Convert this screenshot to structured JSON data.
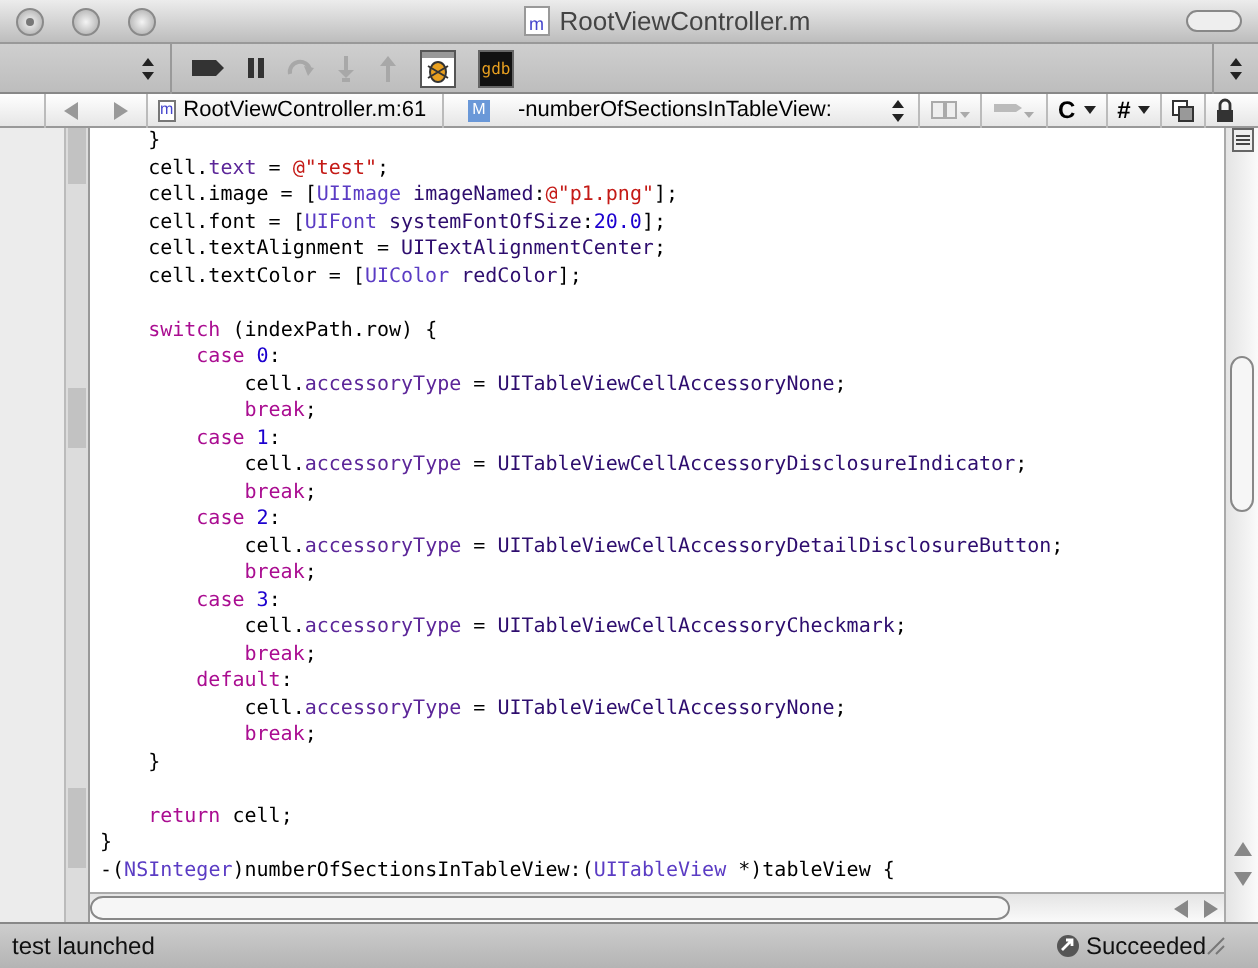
{
  "window": {
    "title": "RootViewController.m",
    "file_icon": "m"
  },
  "toolbar": {
    "buttons": [
      {
        "kind": "breakpoint",
        "disabled": false
      },
      {
        "kind": "pause",
        "disabled": false
      },
      {
        "kind": "step-over",
        "disabled": true
      },
      {
        "kind": "step-into",
        "disabled": true
      },
      {
        "kind": "step-out",
        "disabled": true
      },
      {
        "kind": "debugger",
        "disabled": false
      },
      {
        "kind": "gdb",
        "label": "gdb",
        "disabled": false
      }
    ]
  },
  "navigation": {
    "file_popup": "RootViewController.m:61",
    "file_icon": "m",
    "function_icon": "M",
    "function_popup": "-numberOfSectionsInTableView:",
    "language_menu": "C",
    "pragma_menu": "#"
  },
  "editor": {
    "lines": [
      {
        "kind": "code",
        "tokens": [
          {
            "kind": "plain",
            "text": "    }"
          }
        ]
      },
      {
        "kind": "code",
        "tokens": [
          {
            "kind": "plain",
            "text": "    cell."
          },
          {
            "kind": "property",
            "text": "text"
          },
          {
            "kind": "plain",
            "text": " = "
          },
          {
            "kind": "string",
            "text": "@\"test\""
          },
          {
            "kind": "plain",
            "text": ";"
          }
        ]
      },
      {
        "kind": "code",
        "tokens": [
          {
            "kind": "plain",
            "text": "    cell.image = ["
          },
          {
            "kind": "class",
            "text": "UIImage "
          },
          {
            "kind": "method",
            "text": "imageNamed"
          },
          {
            "kind": "plain",
            "text": ":"
          },
          {
            "kind": "string",
            "text": "@\"p1.png\""
          },
          {
            "kind": "plain",
            "text": "];"
          }
        ]
      },
      {
        "kind": "code",
        "tokens": [
          {
            "kind": "plain",
            "text": "    cell.font = ["
          },
          {
            "kind": "class",
            "text": "UIFont "
          },
          {
            "kind": "method",
            "text": "systemFontOfSize"
          },
          {
            "kind": "plain",
            "text": ":"
          },
          {
            "kind": "number",
            "text": "20.0"
          },
          {
            "kind": "plain",
            "text": "];"
          }
        ]
      },
      {
        "kind": "code",
        "tokens": [
          {
            "kind": "plain",
            "text": "    cell.textAlignment = "
          },
          {
            "kind": "method",
            "text": "UITextAlignmentCenter"
          },
          {
            "kind": "plain",
            "text": ";"
          }
        ]
      },
      {
        "kind": "code",
        "tokens": [
          {
            "kind": "plain",
            "text": "    cell.textColor = ["
          },
          {
            "kind": "class",
            "text": "UIColor "
          },
          {
            "kind": "method",
            "text": "redColor"
          },
          {
            "kind": "plain",
            "text": "];"
          }
        ]
      },
      {
        "kind": "blank"
      },
      {
        "kind": "code",
        "tokens": [
          {
            "kind": "keyword",
            "text": "    switch"
          },
          {
            "kind": "plain",
            "text": " (indexPath.row) {"
          }
        ]
      },
      {
        "kind": "code",
        "tokens": [
          {
            "kind": "keyword",
            "text": "        case "
          },
          {
            "kind": "number",
            "text": "0"
          },
          {
            "kind": "plain",
            "text": ":"
          }
        ]
      },
      {
        "kind": "code",
        "tokens": [
          {
            "kind": "plain",
            "text": "            cell."
          },
          {
            "kind": "property",
            "text": "accessoryType"
          },
          {
            "kind": "plain",
            "text": " = "
          },
          {
            "kind": "method",
            "text": "UITableViewCellAccessoryNone"
          },
          {
            "kind": "plain",
            "text": ";"
          }
        ]
      },
      {
        "kind": "code",
        "tokens": [
          {
            "kind": "keyword",
            "text": "            break"
          },
          {
            "kind": "plain",
            "text": ";"
          }
        ]
      },
      {
        "kind": "code",
        "tokens": [
          {
            "kind": "keyword",
            "text": "        case "
          },
          {
            "kind": "number",
            "text": "1"
          },
          {
            "kind": "plain",
            "text": ":"
          }
        ]
      },
      {
        "kind": "code",
        "tokens": [
          {
            "kind": "plain",
            "text": "            cell."
          },
          {
            "kind": "property",
            "text": "accessoryType"
          },
          {
            "kind": "plain",
            "text": " = "
          },
          {
            "kind": "method",
            "text": "UITableViewCellAccessoryDisclosureIndicator"
          },
          {
            "kind": "plain",
            "text": ";"
          }
        ]
      },
      {
        "kind": "code",
        "tokens": [
          {
            "kind": "keyword",
            "text": "            break"
          },
          {
            "kind": "plain",
            "text": ";"
          }
        ]
      },
      {
        "kind": "code",
        "tokens": [
          {
            "kind": "keyword",
            "text": "        case "
          },
          {
            "kind": "number",
            "text": "2"
          },
          {
            "kind": "plain",
            "text": ":"
          }
        ]
      },
      {
        "kind": "code",
        "tokens": [
          {
            "kind": "plain",
            "text": "            cell."
          },
          {
            "kind": "property",
            "text": "accessoryType"
          },
          {
            "kind": "plain",
            "text": " = "
          },
          {
            "kind": "method",
            "text": "UITableViewCellAccessoryDetailDisclosureButton"
          },
          {
            "kind": "plain",
            "text": ";"
          }
        ]
      },
      {
        "kind": "code",
        "tokens": [
          {
            "kind": "keyword",
            "text": "            break"
          },
          {
            "kind": "plain",
            "text": ";"
          }
        ]
      },
      {
        "kind": "code",
        "tokens": [
          {
            "kind": "keyword",
            "text": "        case "
          },
          {
            "kind": "number",
            "text": "3"
          },
          {
            "kind": "plain",
            "text": ":"
          }
        ]
      },
      {
        "kind": "code",
        "tokens": [
          {
            "kind": "plain",
            "text": "            cell."
          },
          {
            "kind": "property",
            "text": "accessoryType"
          },
          {
            "kind": "plain",
            "text": " = "
          },
          {
            "kind": "method",
            "text": "UITableViewCellAccessoryCheckmark"
          },
          {
            "kind": "plain",
            "text": ";"
          }
        ]
      },
      {
        "kind": "code",
        "tokens": [
          {
            "kind": "keyword",
            "text": "            break"
          },
          {
            "kind": "plain",
            "text": ";"
          }
        ]
      },
      {
        "kind": "code",
        "tokens": [
          {
            "kind": "keyword",
            "text": "        default"
          },
          {
            "kind": "plain",
            "text": ":"
          }
        ]
      },
      {
        "kind": "code",
        "tokens": [
          {
            "kind": "plain",
            "text": "            cell."
          },
          {
            "kind": "property",
            "text": "accessoryType"
          },
          {
            "kind": "plain",
            "text": " = "
          },
          {
            "kind": "method",
            "text": "UITableViewCellAccessoryNone"
          },
          {
            "kind": "plain",
            "text": ";"
          }
        ]
      },
      {
        "kind": "code",
        "tokens": [
          {
            "kind": "keyword",
            "text": "            break"
          },
          {
            "kind": "plain",
            "text": ";"
          }
        ]
      },
      {
        "kind": "code",
        "tokens": [
          {
            "kind": "plain",
            "text": "    }"
          }
        ]
      },
      {
        "kind": "blank"
      },
      {
        "kind": "code",
        "tokens": [
          {
            "kind": "keyword",
            "text": "    return"
          },
          {
            "kind": "plain",
            "text": " cell;"
          }
        ]
      },
      {
        "kind": "code",
        "tokens": [
          {
            "kind": "plain",
            "text": "}"
          }
        ]
      },
      {
        "kind": "code",
        "tokens": [
          {
            "kind": "plain",
            "text": "-("
          },
          {
            "kind": "class",
            "text": "NSInteger"
          },
          {
            "kind": "plain",
            "text": ")numberOfSectionsInTableView:("
          },
          {
            "kind": "class",
            "text": "UITableView"
          },
          {
            "kind": "plain",
            "text": " *)tableView {"
          }
        ]
      }
    ]
  },
  "status_bar": {
    "message": "test launched",
    "build_status": "Succeeded"
  }
}
